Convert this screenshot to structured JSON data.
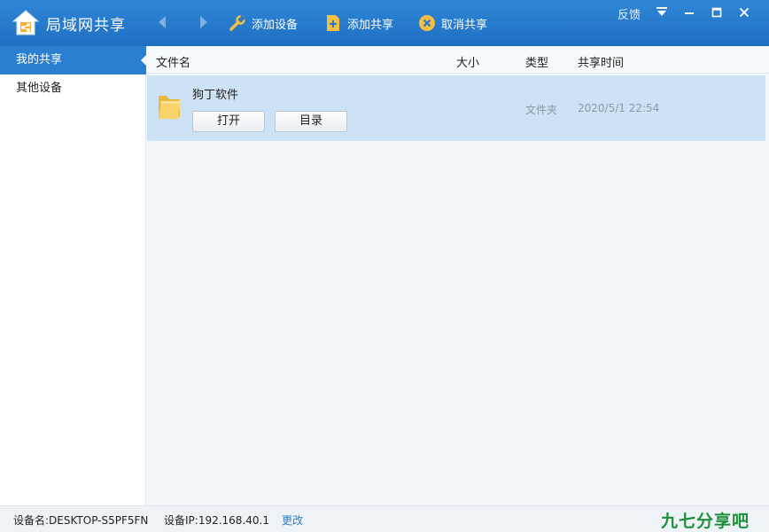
{
  "app": {
    "title": "局域网共享"
  },
  "toolbar": {
    "add_device": "添加设备",
    "add_share": "添加共享",
    "cancel_share": "取消共享"
  },
  "window": {
    "feedback": "反馈"
  },
  "sidebar": {
    "items": [
      {
        "label": "我的共享",
        "active": true
      },
      {
        "label": "其他设备",
        "active": false
      }
    ]
  },
  "table": {
    "columns": [
      "文件名",
      "大小",
      "类型",
      "共享时间"
    ],
    "rows": [
      {
        "name": "狗丁软件",
        "size": "",
        "type": "文件夹",
        "time": "2020/5/1 22:54",
        "open_label": "打开",
        "dir_label": "目录"
      }
    ]
  },
  "status": {
    "device_name": "设备名:DESKTOP-S5PF5FN",
    "device_ip": "设备IP:192.168.40.1",
    "change": "更改"
  },
  "watermark": "九七分享吧",
  "colors": {
    "accent": "#2a7fd0",
    "titlebar": "#2478cb",
    "row_selected": "#cde3f5"
  }
}
